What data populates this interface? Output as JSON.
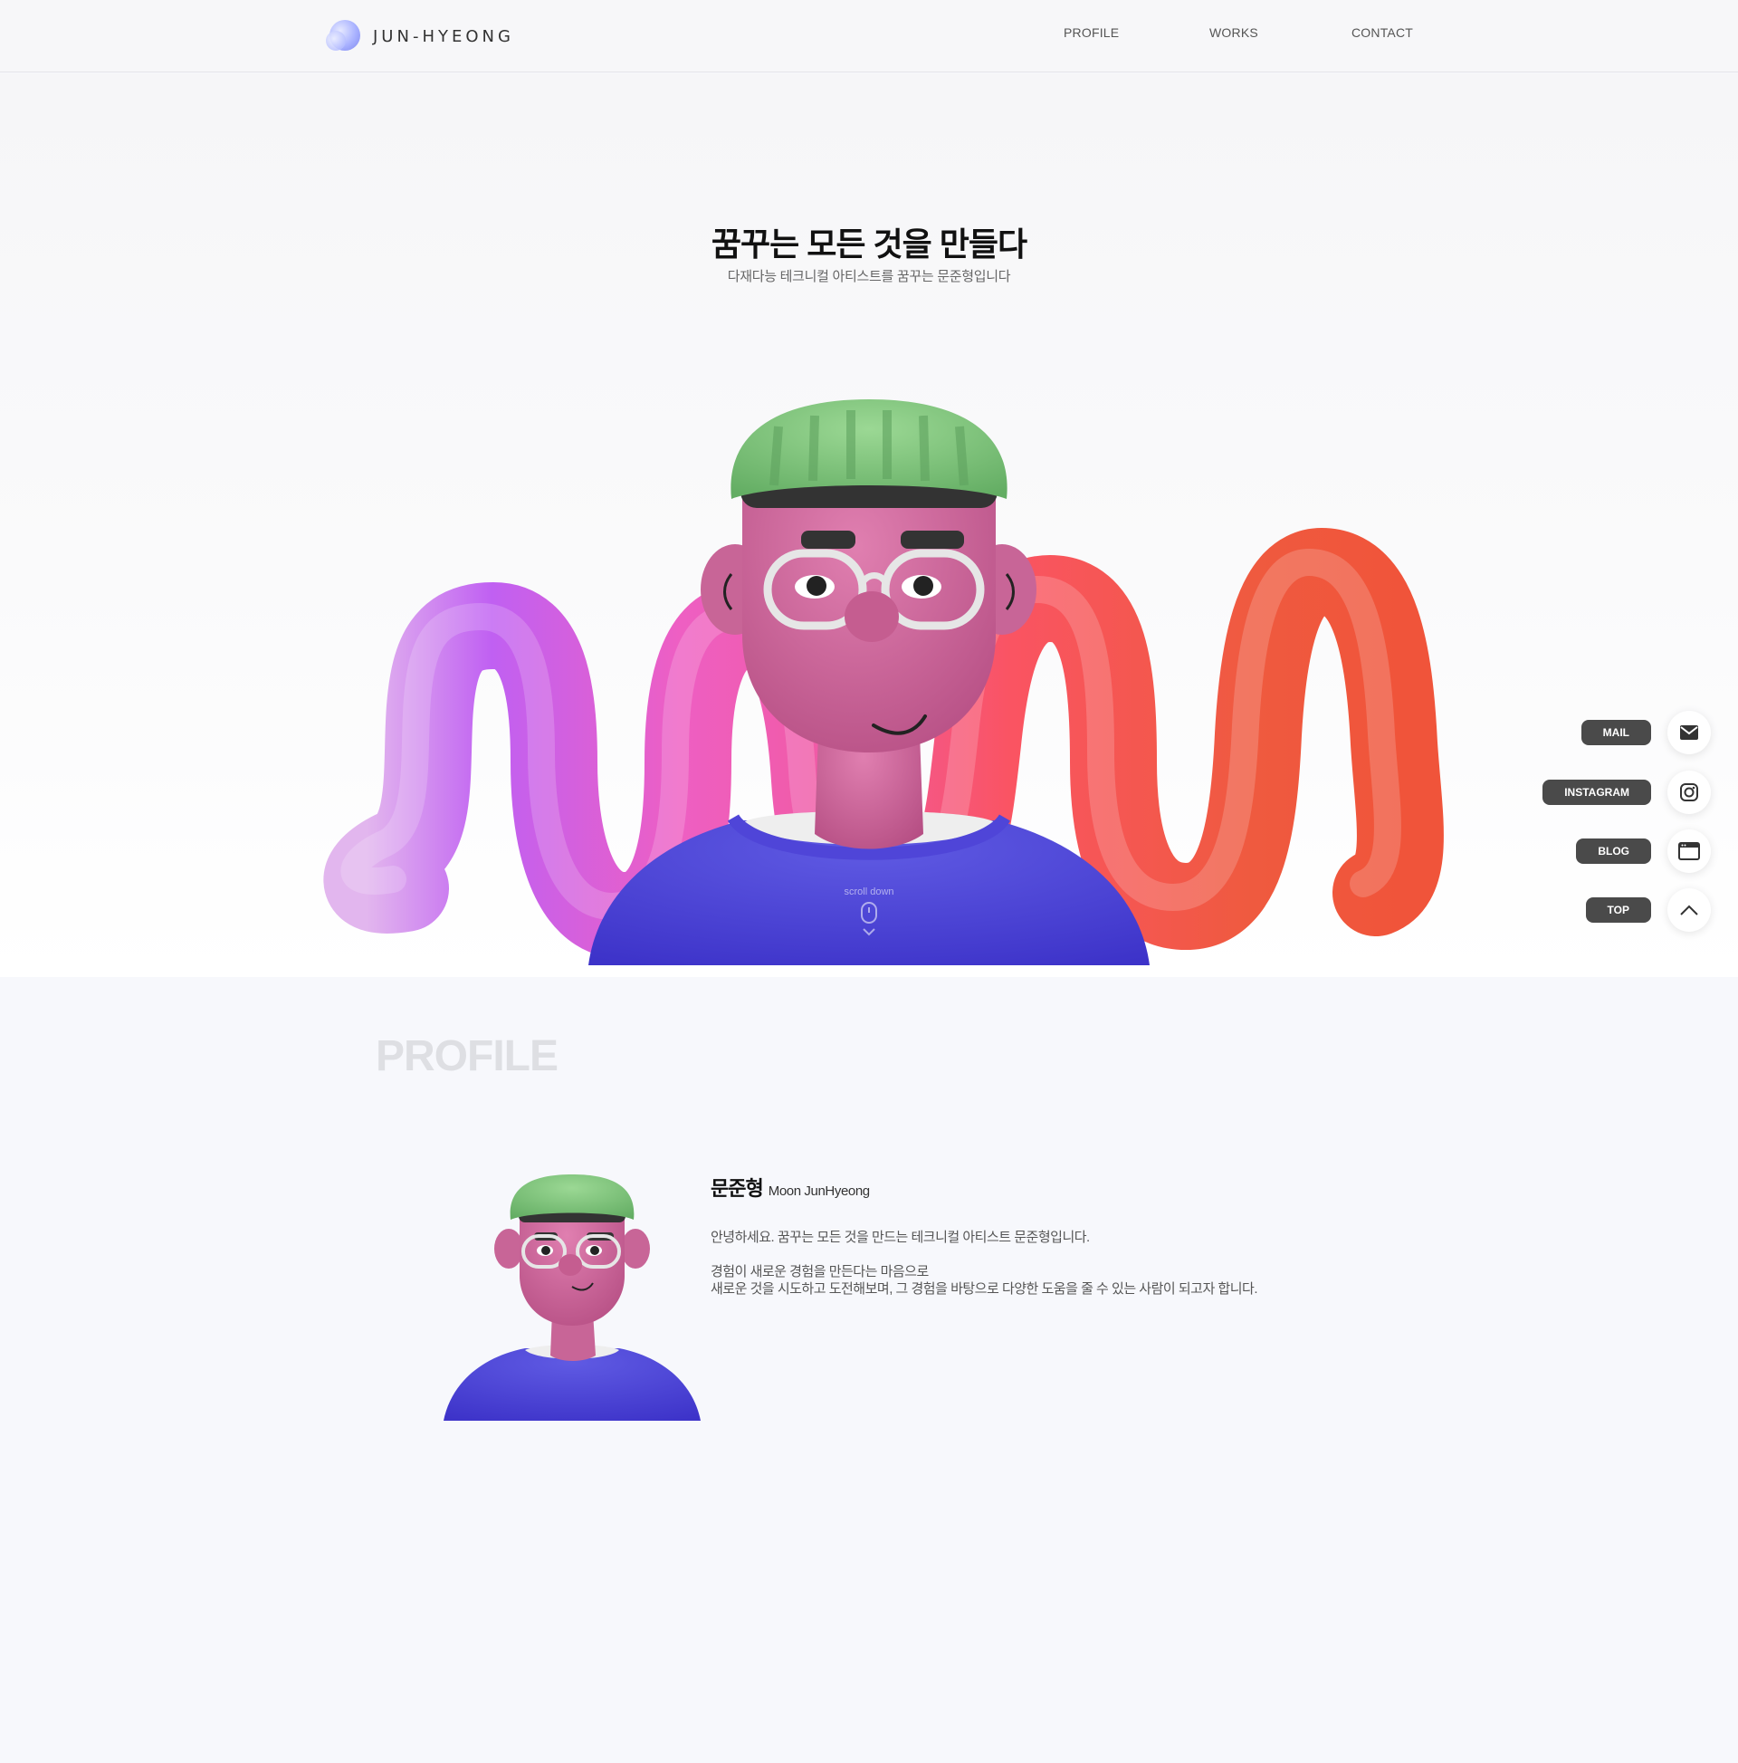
{
  "header": {
    "logo_text": "JUN-HYEONG",
    "nav": [
      {
        "label": "PROFILE"
      },
      {
        "label": "WORKS"
      },
      {
        "label": "CONTACT"
      }
    ]
  },
  "hero": {
    "title": "꿈꾸는 모든 것을 만들다",
    "subtitle": "다재다능 테크니컬 아티스트를 꿈꾸는 문준형입니다",
    "scroll_label": "scroll down"
  },
  "side_links": [
    {
      "label": "MAIL",
      "icon": "mail-icon"
    },
    {
      "label": "INSTAGRAM",
      "icon": "instagram-icon"
    },
    {
      "label": "BLOG",
      "icon": "blog-window-icon"
    },
    {
      "label": "TOP",
      "icon": "chevron-up-icon"
    }
  ],
  "profile": {
    "heading": "PROFILE",
    "name_ko": "문준형",
    "name_en": "Moon JunHyeong",
    "intro": "안녕하세요. 꿈꾸는 모든 것을 만드는 테크니컬 아티스트 문준형입니다.",
    "body_line1": "경험이 새로운 경험을 만든다는 마음으로",
    "body_line2": "새로운 것을 시도하고 도전해보며, 그 경험을 바탕으로 다양한 도움을 줄 수 있는 사람이 되고자 합니다."
  },
  "colors": {
    "accent_dark": "#4a4a4a",
    "tube_start": "#d8a6f0",
    "tube_mid": "#f25ec0",
    "tube_end": "#f0583a",
    "shirt": "#4b3fd6",
    "skin": "#d2679a",
    "beanie": "#7fc77a"
  }
}
